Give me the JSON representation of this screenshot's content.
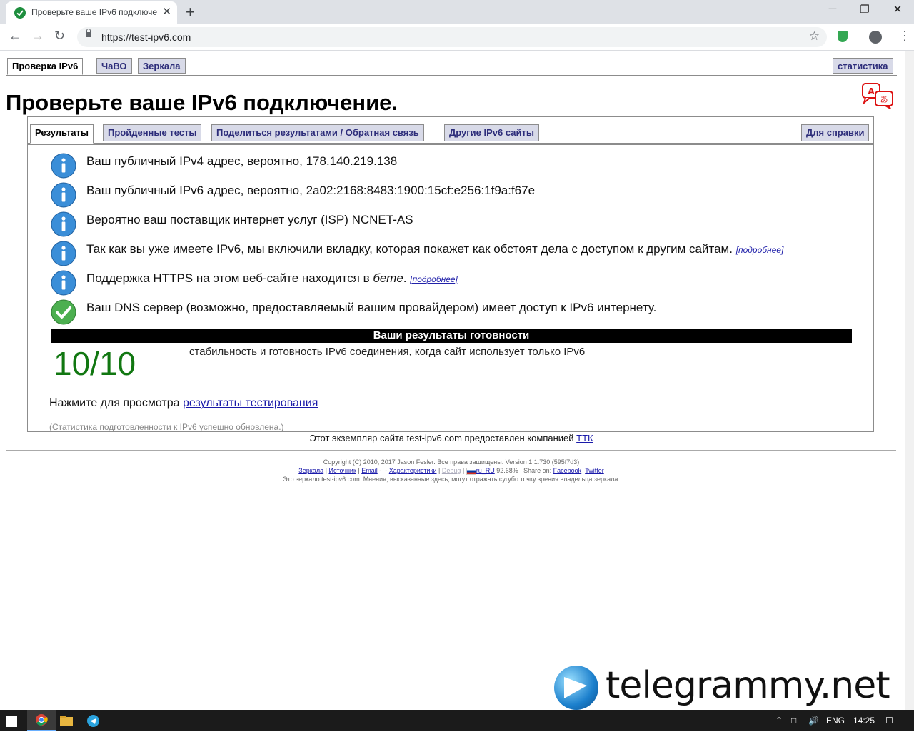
{
  "browser": {
    "tab_title": "Проверьте ваше IPv6 подключе",
    "tab_close": "✕",
    "new_tab": "+",
    "url": "https://test-ipv6.com",
    "win_min": "─",
    "win_max": "❐",
    "win_close": "✕"
  },
  "top_tabs": [
    "Проверка IPv6",
    "ЧаВО",
    "Зеркала"
  ],
  "stats_tab": "статистика",
  "title": "Проверьте ваше IPv6 подключение.",
  "inner_tabs": [
    "Результаты",
    "Пройденные тесты",
    "Поделиться результатами / Обратная связь",
    "Другие IPv6 сайты"
  ],
  "help_tab": "Для справки",
  "results": [
    {
      "icon": "info",
      "text": "Ваш публичный IPv4 адрес, вероятно, 178.140.219.138",
      "more": ""
    },
    {
      "icon": "info",
      "text": "Ваш публичный IPv6 адрес, вероятно, 2a02:2168:8483:1900:15cf:e256:1f9a:f67e",
      "more": ""
    },
    {
      "icon": "info",
      "text": "Вероятно ваш поставщик интернет услуг (ISP) NCNET-AS",
      "more": ""
    },
    {
      "icon": "info",
      "text": "Так как вы уже имеете IPv6, мы включили вкладку, которая покажет как обстоят дела с доступом к другим сайтам.",
      "more": "[подробнее]"
    },
    {
      "icon": "info",
      "text_pre": "Поддержка HTTPS на этом веб-сайте находится в ",
      "text_em": "бете",
      "text_post": ".",
      "more": "[подробнее]"
    },
    {
      "icon": "check",
      "text": "Ваш DNS сервер (возможно, предоставляемый вашим провайдером) имеет доступ к IPv6 интернету.",
      "more": ""
    }
  ],
  "readiness_header": "Ваши результаты готовности",
  "score": "10/10",
  "score_desc": "стабильность и готовность IPv6 соединения, когда сайт использует только IPv6",
  "click_prefix": "Нажмите для просмотра ",
  "click_link": "результаты тестирования",
  "stats_updated": "(Статистика подготовленности к IPv6 успешно обновлена.)",
  "provided_by_prefix": "Этот экземпляр сайта test-ipv6.com предоставлен компанией ",
  "provided_by_link": "ТТК",
  "footer": {
    "copyright": "Copyright (C) 2010, 2017 Jason Fesler. Все права защищены. Version 1.1.730 (595f7d3)",
    "links": [
      "Зеркала",
      "Источник",
      "Email",
      "Характеристики",
      "Debug",
      "ru_RU"
    ],
    "locale_pct": "92.68%",
    "share_on": "Share on:",
    "share_links": [
      "Facebook",
      "Twitter"
    ],
    "disclaimer": "Это зеркало test-ipv6.com. Мнения, высказанные здесь, могут отражать сугубо точку зрения владельца зеркала."
  },
  "watermark": "telegrammy.net",
  "taskbar": {
    "lang": "ENG",
    "time": "14:25"
  },
  "colors": {
    "score_green": "#117711",
    "tab_bg": "#d8dae8",
    "tab_text": "#2d2d7a",
    "info_blue": "#3a8ed8",
    "check_green": "#4caf50"
  }
}
